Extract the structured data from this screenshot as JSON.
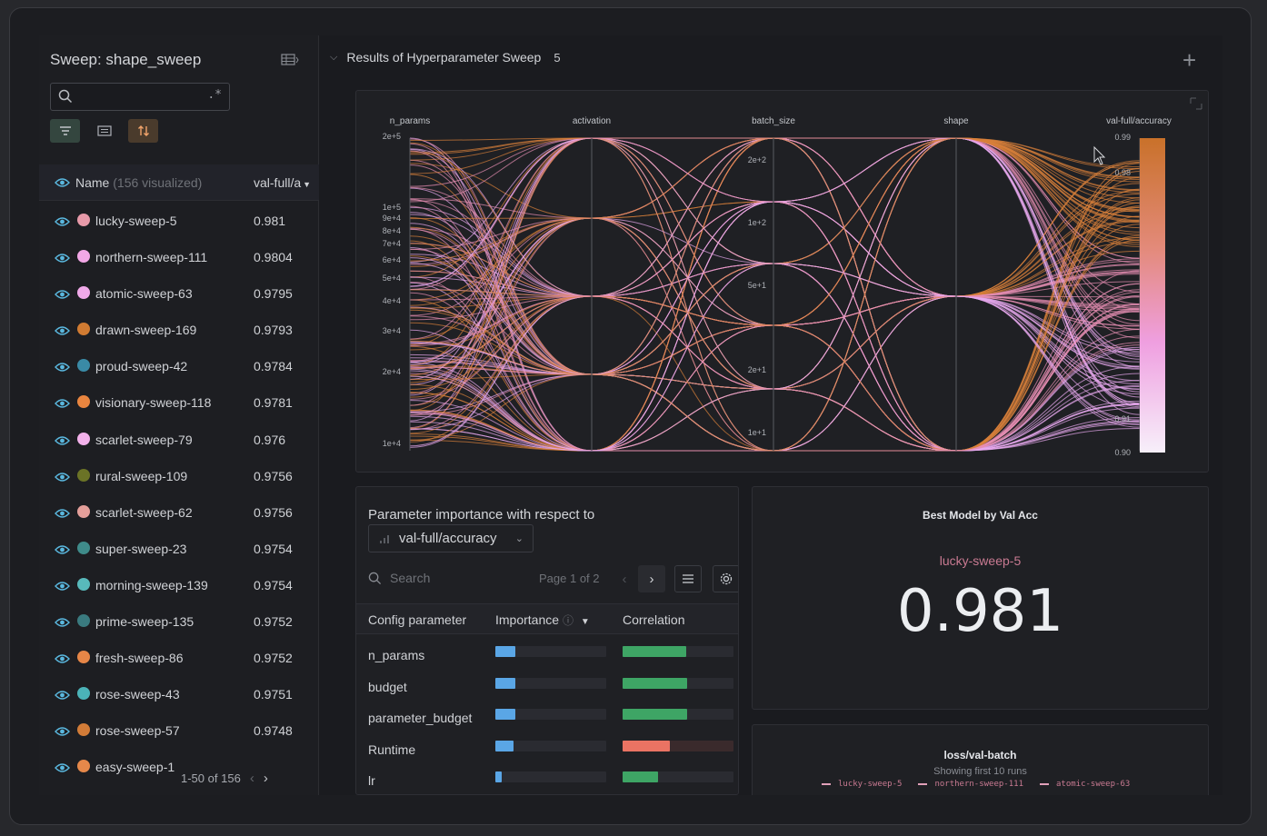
{
  "sidebar": {
    "title": "Sweep: shape_sweep",
    "search_placeholder": "",
    "regex_glyph": ".*",
    "header": {
      "name": "Name",
      "visualized": "(156 visualized)",
      "value_col": "val-full/a"
    },
    "runs": [
      {
        "name": "lucky-sweep-5",
        "value": "0.981",
        "color": "#e79aa9"
      },
      {
        "name": "northern-sweep-111",
        "value": "0.9804",
        "color": "#f2a7e6"
      },
      {
        "name": "atomic-sweep-63",
        "value": "0.9795",
        "color": "#f0a9e9"
      },
      {
        "name": "drawn-sweep-169",
        "value": "0.9793",
        "color": "#d07b32"
      },
      {
        "name": "proud-sweep-42",
        "value": "0.9784",
        "color": "#3a8aa6"
      },
      {
        "name": "visionary-sweep-118",
        "value": "0.9781",
        "color": "#e9853f"
      },
      {
        "name": "scarlet-sweep-79",
        "value": "0.976",
        "color": "#f2b1ea"
      },
      {
        "name": "rural-sweep-109",
        "value": "0.9756",
        "color": "#6b7326"
      },
      {
        "name": "scarlet-sweep-62",
        "value": "0.9756",
        "color": "#e49f9a"
      },
      {
        "name": "super-sweep-23",
        "value": "0.9754",
        "color": "#3f8b8a"
      },
      {
        "name": "morning-sweep-139",
        "value": "0.9754",
        "color": "#58b9bb"
      },
      {
        "name": "prime-sweep-135",
        "value": "0.9752",
        "color": "#3a7a7f"
      },
      {
        "name": "fresh-sweep-86",
        "value": "0.9752",
        "color": "#e68647"
      },
      {
        "name": "rose-sweep-43",
        "value": "0.9751",
        "color": "#4bb3b8"
      },
      {
        "name": "rose-sweep-57",
        "value": "0.9748",
        "color": "#d27c38"
      },
      {
        "name": "easy-sweep-1",
        "value": "",
        "color": "#e6884a"
      }
    ],
    "pager": {
      "label": "1-50",
      "of": "of 156"
    }
  },
  "section": {
    "title": "Results of Hyperparameter Sweep",
    "count": "5"
  },
  "parallel_coords": {
    "axes": [
      {
        "name": "n_params",
        "ticks": [
          "2e+5",
          "1e+5",
          "9e+4",
          "8e+4",
          "7e+4",
          "6e+4",
          "5e+4",
          "4e+4",
          "3e+4",
          "2e+4",
          "1e+4"
        ]
      },
      {
        "name": "activation",
        "ticks": []
      },
      {
        "name": "batch_size",
        "ticks": [
          "2e+2",
          "1e+2",
          "5e+1",
          "2e+1",
          "1e+1"
        ]
      },
      {
        "name": "shape",
        "ticks": []
      },
      {
        "name": "val-full/accuracy",
        "ticks": [
          "0.99",
          "0.98",
          "0.91",
          "0.90"
        ]
      }
    ]
  },
  "importance": {
    "title": "Parameter importance with respect to",
    "metric": "val-full/accuracy",
    "search_placeholder": "Search",
    "page": "Page 1 of 2",
    "columns": {
      "param": "Config parameter",
      "importance": "Importance",
      "correlation": "Correlation"
    },
    "rows": [
      {
        "name": "n_params",
        "importance": 0.18,
        "correlation": 0.57,
        "corr_sign": "positive"
      },
      {
        "name": "budget",
        "importance": 0.18,
        "correlation": 0.58,
        "corr_sign": "positive"
      },
      {
        "name": "parameter_budget",
        "importance": 0.18,
        "correlation": 0.58,
        "corr_sign": "positive"
      },
      {
        "name": "Runtime",
        "importance": 0.16,
        "correlation": 0.43,
        "corr_sign": "negative"
      },
      {
        "name": "lr",
        "importance": 0.06,
        "correlation": 0.32,
        "corr_sign": "positive"
      }
    ],
    "colors": {
      "importance": "#5aa6e6",
      "positive": "#3ea565",
      "negative": "#ea7363"
    }
  },
  "best_model": {
    "title": "Best Model by Val Acc",
    "run": "lucky-sweep-5",
    "value": "0.981"
  },
  "loss_panel": {
    "title": "loss/val-batch",
    "subtitle": "Showing first 10 runs",
    "legend": [
      "lucky-sweep-5",
      "northern-sweep-111",
      "atomic-sweep-63"
    ]
  }
}
